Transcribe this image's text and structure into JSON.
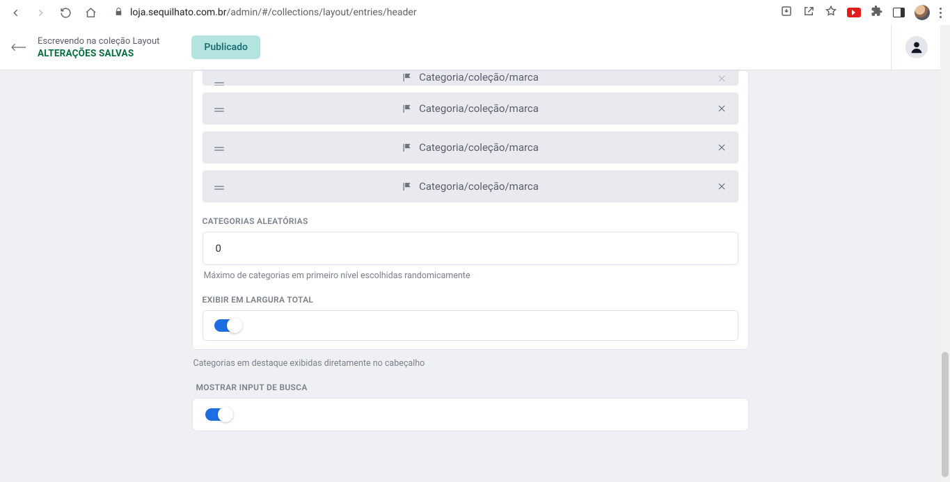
{
  "browser": {
    "url_host": "loja.sequilhato.com.br",
    "url_path": "/admin/#/collections/layout/entries/header"
  },
  "toolbar": {
    "crumb_line1": "Escrevendo na coleção Layout",
    "crumb_line2": "ALTERAÇÕES SALVAS",
    "status_pill": "Publicado"
  },
  "rows": [
    {
      "label": "Categoria/coleção/marca"
    },
    {
      "label": "Categoria/coleção/marca"
    },
    {
      "label": "Categoria/coleção/marca"
    },
    {
      "label": "Categoria/coleção/marca"
    }
  ],
  "random_categories": {
    "label": "CATEGORIAS ALEATÓRIAS",
    "value": "0",
    "hint": "Máximo de categorias em primeiro nível escolhidas randomicamente"
  },
  "full_width": {
    "label": "EXIBIR EM LARGURA TOTAL",
    "on": true
  },
  "outer_hint": "Categorias em destaque exibidas diretamente no cabeçalho",
  "show_search": {
    "label": "MOSTRAR INPUT DE BUSCA",
    "on": true
  }
}
